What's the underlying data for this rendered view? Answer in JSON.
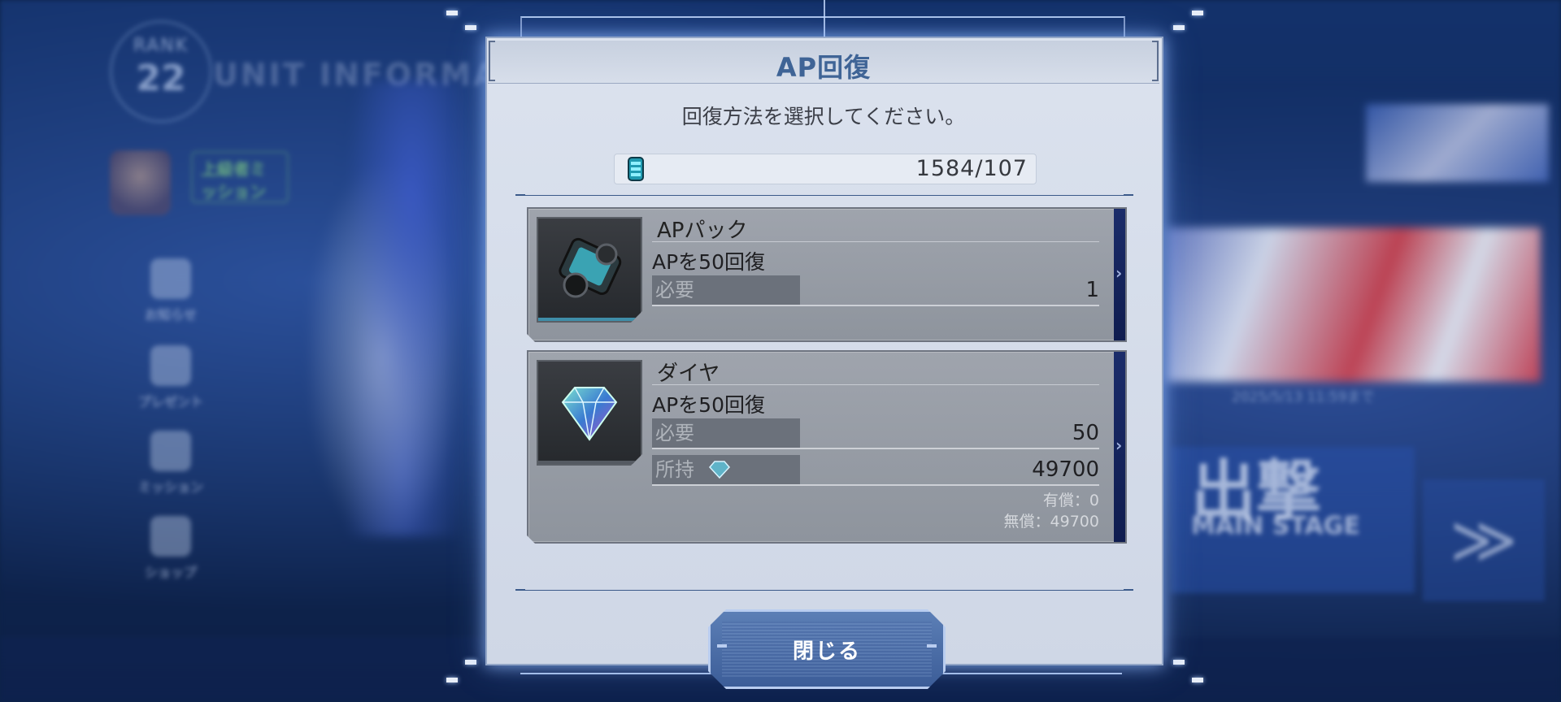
{
  "background": {
    "rank_label": "RANK",
    "rank_value": "22",
    "unit_title": "UNIT INFORMATI",
    "mission_chip": "上級者ミッション",
    "sidebar": [
      "お知らせ",
      "プレゼント",
      "ミッション",
      "ショップ"
    ],
    "event_date": "2025/5/13 11:59まで",
    "sortie_label": "出撃",
    "sortie_sub": "MAIN STAGE",
    "start_label": "≫"
  },
  "modal": {
    "title": "AP回復",
    "prompt": "回復方法を選択してください。",
    "ap_display": "1584/107",
    "items": [
      {
        "name": "APパック",
        "effect": "APを50回復",
        "required_label": "必要",
        "required_value": "1"
      },
      {
        "name": "ダイヤ",
        "effect": "APを50回復",
        "required_label": "必要",
        "required_value": "50",
        "owned_label": "所持",
        "owned_value": "49700",
        "paid_note": "有償：0",
        "free_note": "無償：49700"
      }
    ],
    "close_label": "閉じる"
  },
  "colors": {
    "title_blue": "#3f6496",
    "card_gray": "#9fa4ad",
    "button_blue": "#3c5d98"
  },
  "icons": [
    "ap-battery-icon",
    "ap-pack-icon",
    "diamond-icon",
    "gem-small-icon",
    "chevron-right-icon"
  ]
}
